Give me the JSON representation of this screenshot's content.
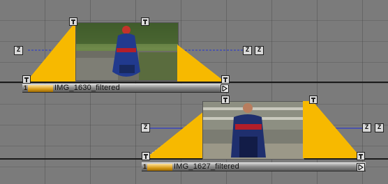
{
  "timeline": {
    "clips": [
      {
        "number": "1",
        "name": "IMG_1630_filtered",
        "z_left": "Z",
        "z_right_a": "Z",
        "z_right_b": "Z"
      },
      {
        "number": "1",
        "name": "IMG_1627_filtered",
        "z_left": "Z",
        "z_right_a": "Z",
        "z_right_b": "Z"
      }
    ]
  },
  "colors": {
    "background": "#7b7b7b",
    "fade_ramp": "#f7b900",
    "guide_line": "#1b2bd8",
    "clip_label_accent": "#d79a16"
  },
  "icons": {
    "handle": "keyframe-handle-icon",
    "end": "play-end-icon"
  }
}
